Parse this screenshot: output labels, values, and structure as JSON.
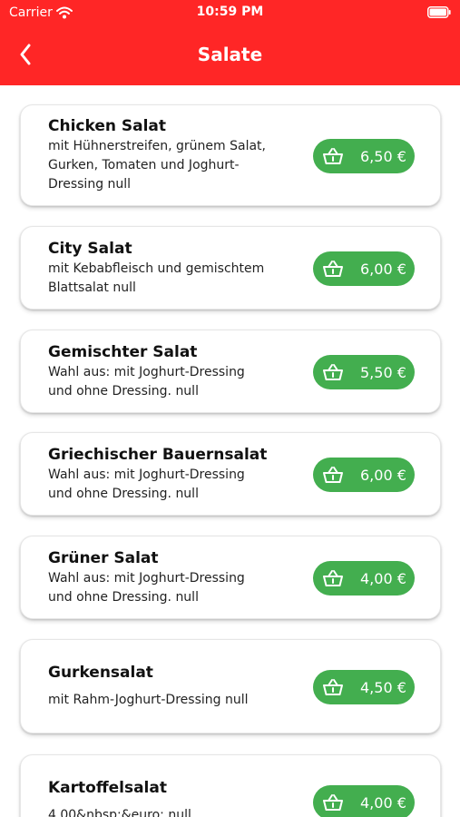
{
  "status_bar": {
    "carrier": "Carrier",
    "time": "10:59 PM"
  },
  "nav": {
    "title": "Salate"
  },
  "colors": {
    "header": "#ff2626",
    "price_button": "#43ae4f"
  },
  "items": [
    {
      "name": "Chicken Salat",
      "desc_lines": [
        "mit Hühnerstreifen, grünem Salat,",
        "Gurken, Tomaten und Joghurt-",
        "Dressing null"
      ],
      "price": "6,50 €"
    },
    {
      "name": "City Salat",
      "desc_lines": [
        "mit Kebabfleisch und gemischtem",
        "Blattsalat null"
      ],
      "price": "6,00 €"
    },
    {
      "name": "Gemischter Salat",
      "desc_lines": [
        "Wahl aus: mit Joghurt-Dressing",
        "und ohne Dressing. null"
      ],
      "price": "5,50 €"
    },
    {
      "name": "Griechischer Bauernsalat",
      "desc_lines": [
        "Wahl aus: mit Joghurt-Dressing",
        "und ohne Dressing. null"
      ],
      "price": "6,00 €"
    },
    {
      "name": "Grüner Salat",
      "desc_lines": [
        "Wahl aus: mit Joghurt-Dressing",
        "und ohne Dressing. null"
      ],
      "price": "4,00 €"
    },
    {
      "name": "Gurkensalat",
      "desc_lines": [
        "mit Rahm-Joghurt-Dressing null"
      ],
      "price": "4,50 €"
    },
    {
      "name": "Kartoffelsalat",
      "desc_lines": [
        "4,00&nbsp;&euro; null"
      ],
      "price": "4,00 €"
    }
  ]
}
